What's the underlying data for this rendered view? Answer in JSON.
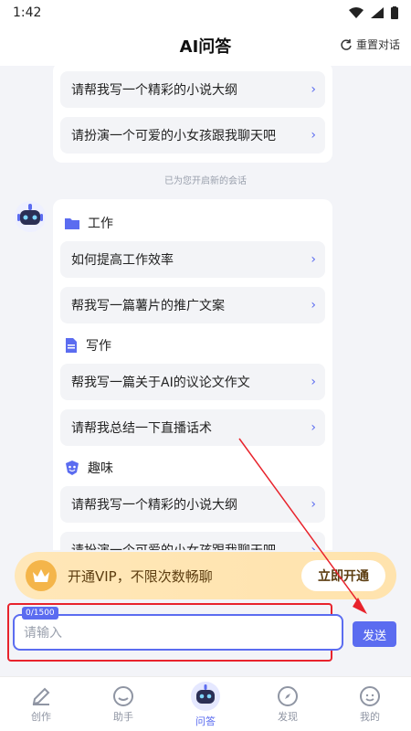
{
  "status": {
    "time": "1:42"
  },
  "header": {
    "title": "AI问答",
    "reset_label": "重置对话"
  },
  "chat": {
    "top_card": {
      "items": [
        "请帮我写一个精彩的小说大纲",
        "请扮演一个可爱的小女孩跟我聊天吧"
      ]
    },
    "new_session_notice": "已为您开启新的会话",
    "sections": [
      {
        "title": "工作",
        "icon": "folder-icon",
        "items": [
          "如何提高工作效率",
          "帮我写一篇薯片的推广文案"
        ]
      },
      {
        "title": "写作",
        "icon": "document-icon",
        "items": [
          "帮我写一篇关于AI的议论文作文",
          "请帮我总结一下直播话术"
        ]
      },
      {
        "title": "趣味",
        "icon": "fun-icon",
        "items": [
          "请帮我写一个精彩的小说大纲",
          "请扮演一个可爱的小女孩跟我聊天吧"
        ]
      }
    ]
  },
  "vip": {
    "text": "开通VIP，不限次数畅聊",
    "button": "立即开通"
  },
  "input": {
    "counter": "0/1500",
    "placeholder": "请输入",
    "send_label": "发送"
  },
  "nav": {
    "items": [
      {
        "label": "创作"
      },
      {
        "label": "助手"
      },
      {
        "label": "问答"
      },
      {
        "label": "发现"
      },
      {
        "label": "我的"
      }
    ],
    "active": "问答"
  },
  "colors": {
    "accent": "#5b6cf0",
    "annotation": "#e8232c",
    "vip_bg": "#ffe7b8"
  }
}
